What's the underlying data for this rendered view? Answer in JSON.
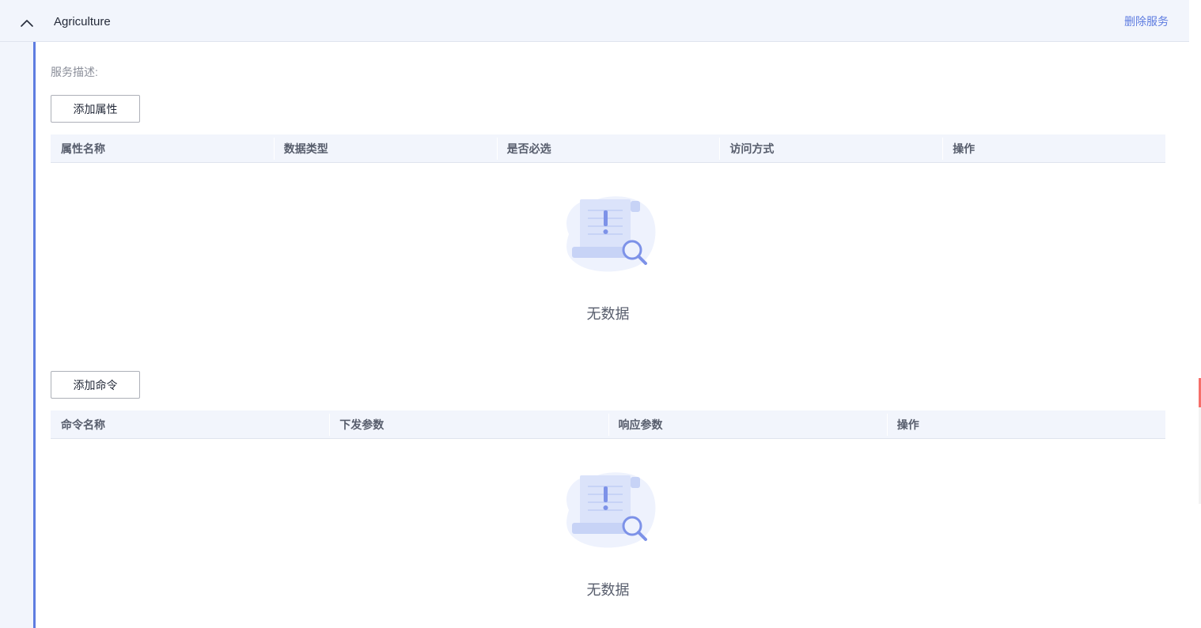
{
  "header": {
    "title": "Agriculture",
    "delete_label": "删除服务"
  },
  "description_label": "服务描述:",
  "properties": {
    "add_button": "添加属性",
    "columns": [
      "属性名称",
      "数据类型",
      "是否必选",
      "访问方式",
      "操作"
    ],
    "empty_text": "无数据"
  },
  "commands": {
    "add_button": "添加命令",
    "columns": [
      "命令名称",
      "下发参数",
      "响应参数",
      "操作"
    ],
    "empty_text": "无数据"
  },
  "colors": {
    "accent": "#5e7ce0",
    "header_bg": "#f2f5fc"
  }
}
